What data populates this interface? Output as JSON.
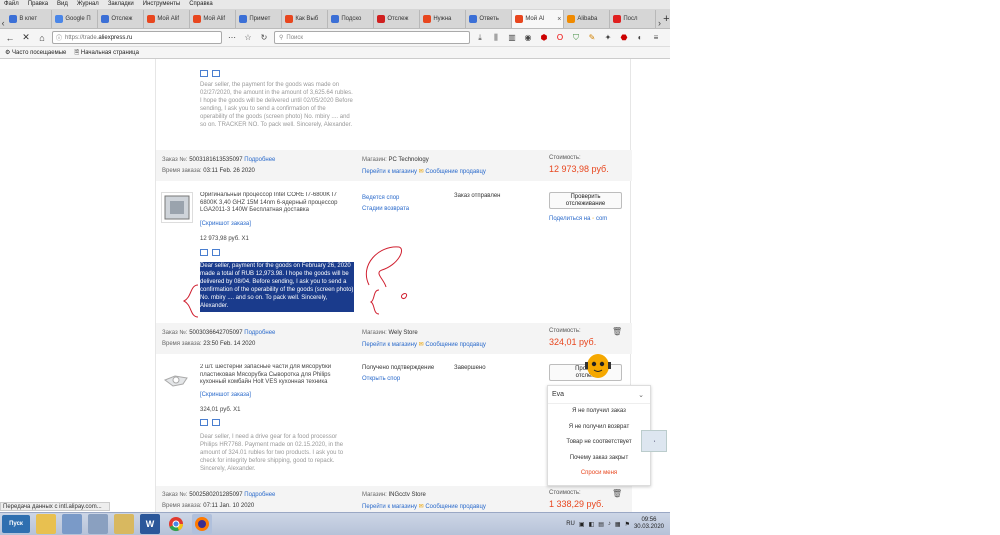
{
  "menu": [
    "Файл",
    "Правка",
    "Вид",
    "Журнал",
    "Закладки",
    "Инструменты",
    "Справка"
  ],
  "tabs": [
    {
      "label": "В клет",
      "fav": "#3b6fd6"
    },
    {
      "label": "Google П",
      "fav": "#4a86e8"
    },
    {
      "label": "Отслеж",
      "fav": "#3b6fd6"
    },
    {
      "label": "Мой Alif",
      "fav": "#e8461e"
    },
    {
      "label": "Мой Alif",
      "fav": "#e8461e"
    },
    {
      "label": "Примет",
      "fav": "#3b6fd6"
    },
    {
      "label": "Как Выб",
      "fav": "#e8461e"
    },
    {
      "label": "Подско",
      "fav": "#3b6fd6"
    },
    {
      "label": "Отслеж",
      "fav": "#d02020"
    },
    {
      "label": "Нужна",
      "fav": "#e8461e"
    },
    {
      "label": "Ответь",
      "fav": "#3b6fd6"
    },
    {
      "label": "Мой Al",
      "fav": "#e8461e",
      "active": true
    },
    {
      "label": "Alibaba",
      "fav": "#f08a00"
    },
    {
      "label": "Посл",
      "fav": "#e02020"
    }
  ],
  "nav": {
    "url_prefix": "https://trade.",
    "url_domain": "aliexpress.ru",
    "url_rest": "/orderList.htm",
    "search_placeholder": "Поиск"
  },
  "bookmarks": [
    "Часто посещаемые",
    "Начальная страница"
  ],
  "order1_msg": "Dear seller, the payment for the goods was made on 02/27/2020, the amount in the amount of 3,625.64 rubles. I hope the goods will be delivered until 02/05/2020 Before sending, I ask you to send a confirmation of the operability of the goods (screen photo) No. mbiry .... and so on. TRACKER NO. To pack well. Sincerely, Alexander.",
  "order2": {
    "num_label": "Заказ №:",
    "num": "5003181613535097",
    "details": "Подробнее",
    "time_label": "Время заказа:",
    "time": "03:11 Feb. 26 2020",
    "store_label": "Магазин:",
    "store": "PC Technology",
    "go_store": "Перейти к магазину",
    "msg_seller": "Сообщение продавцу",
    "cost_label": "Стоимость:",
    "cost": "12 973,98 руб.",
    "title": "Оригинальный процессор Intel CORE I7-6800K I7 6800K 3,40 GHZ 15M 14nm 6-ядерный процессор LGA2011-3 140W Бесплатная доставка",
    "screenshot": "[Скриншот заказа]",
    "price": "12 973,98 руб. X1",
    "dispute": "Ведется спор",
    "return": "Стадии возврата",
    "status": "Заказ отправлен",
    "track_btn": [
      "Проверить",
      "отслеживание"
    ],
    "share": "Поделиться на",
    "share_site": "com",
    "msg": "Dear seller, payment for the goods on February 26, 2020 made a total of RUB 12,973.98. I hope the goods will be delivered by 08/04. Before sending, I ask you to send a confirmation of the operability of the goods (screen photo) No. mbiry .... and so on. To pack well. Sincerely, Alexander."
  },
  "order3": {
    "num_label": "Заказ №:",
    "num": "5003036642705097",
    "details": "Подробнее",
    "time_label": "Время заказа:",
    "time": "23:50 Feb. 14 2020",
    "store_label": "Магазин:",
    "store": "Wely Store",
    "go_store": "Перейти к магазину",
    "msg_seller": "Сообщение продавцу",
    "cost_label": "Стоимость:",
    "cost": "324,01 руб.",
    "title": "2 шт. шестерни запасные части для мясорубки пластиковая Мясорубка Сыворотка для Philips кухонный комбайн Holt VES кухонная техника",
    "screenshot": "[Скриншот заказа]",
    "price": "324,01 руб. X1",
    "received": "Получено подтверждение",
    "open_dispute": "Открыть спор",
    "status": "Завершено",
    "track_btn": [
      "Провер",
      "отслеж"
    ],
    "msg": "Dear seller, I need a drive gear for a food processor Philips HR7768. Payment made on 02.15.2020, in the amount of 324.01 rubles for two products. I ask you to check for integrity before shipping, good to repack. Sincerely, Alexander."
  },
  "order4": {
    "num_label": "Заказ №:",
    "num": "5002580201285097",
    "details": "Подробнее",
    "time_label": "Время заказа:",
    "time": "07:11 Jan. 10 2020",
    "store_label": "Магазин:",
    "store": "INGcctv Store",
    "go_store": "Перейти к магазину",
    "msg_seller": "Сообщение продавцу",
    "cost_label": "Стоимость:",
    "cost": "1 338,29 руб."
  },
  "chat": {
    "name": "Eva",
    "options": [
      "Я не получил заказ",
      "Я не получил возврат",
      "Товар не соответствует",
      "Почему заказ закрыт"
    ],
    "ask": "Спроси меня"
  },
  "status_text": "Передача данных с intl.alipay.com...",
  "taskbar": {
    "start": "Пуск",
    "lang": "RU",
    "time": "09:56",
    "date": "30.03.2020"
  }
}
